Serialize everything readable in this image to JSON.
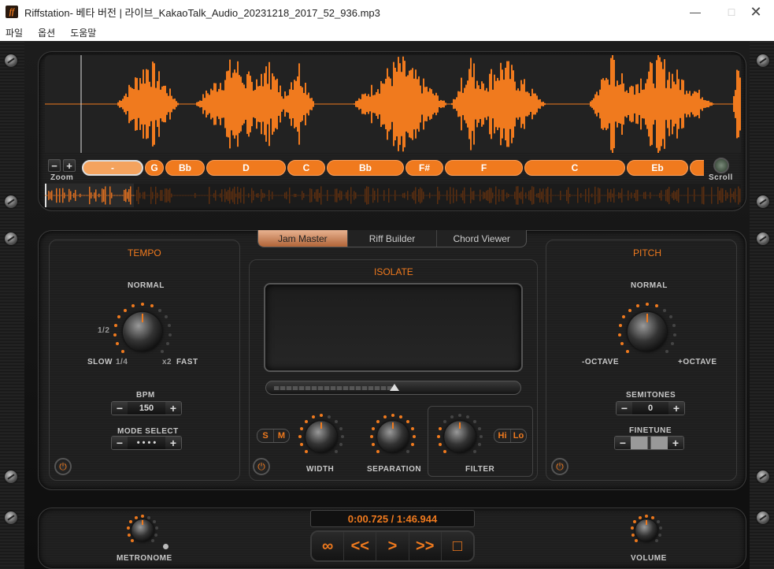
{
  "window": {
    "title": "Riffstation- 베타 버전 | 라이브_KakaoTalk_Audio_20231218_2017_52_936.mp3",
    "logo": "ff"
  },
  "menu": [
    "파일",
    "옵션",
    "도움말"
  ],
  "wave": {
    "zoom_label": "Zoom",
    "scroll_label": "Scroll",
    "chords": [
      {
        "name": "-",
        "current": true
      },
      {
        "name": "G"
      },
      {
        "name": "Bb"
      },
      {
        "name": "D"
      },
      {
        "name": "C"
      },
      {
        "name": "Bb"
      },
      {
        "name": "F#"
      },
      {
        "name": "F"
      },
      {
        "name": "C"
      },
      {
        "name": "Eb"
      },
      {
        "name": ""
      }
    ],
    "colors": {
      "accent": "#f07a1e",
      "bg": "#222222"
    }
  },
  "tabs": [
    {
      "label": "Jam Master",
      "active": true
    },
    {
      "label": "Riff Builder"
    },
    {
      "label": "Chord Viewer"
    }
  ],
  "tempo": {
    "title": "TEMPO",
    "normal": "NORMAL",
    "half": "1/2",
    "slow": "SLOW",
    "quarter": "1/4",
    "x2": "x2",
    "fast": "FAST",
    "bpm_label": "BPM",
    "bpm_value": "150",
    "mode_label": "MODE SELECT",
    "mode_value": "• • • •"
  },
  "isolate": {
    "title": "ISOLATE",
    "s": "S",
    "m": "M",
    "hi": "Hi",
    "lo": "Lo",
    "width": "WIDTH",
    "separation": "SEPARATION",
    "filter": "FILTER",
    "slider_position": 0.5
  },
  "pitch": {
    "title": "PITCH",
    "normal": "NORMAL",
    "minus": "-OCTAVE",
    "plus": "+OCTAVE",
    "semitones_label": "SEMITONES",
    "semitones_value": "0",
    "finetune_label": "FINETUNE"
  },
  "transport": {
    "time": "0:00.725 / 1:46.944",
    "metronome": "METRONOME",
    "volume": "VOLUME",
    "buttons": {
      "loop": "∞",
      "rewind": "<<",
      "play": ">",
      "forward": ">>",
      "stop": "□"
    }
  }
}
